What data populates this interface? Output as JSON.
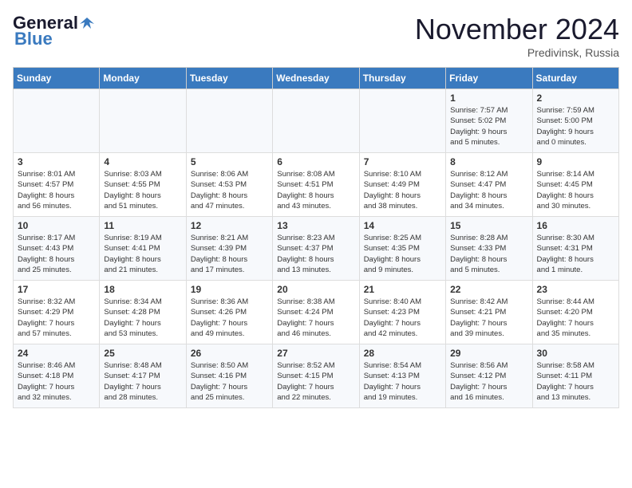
{
  "header": {
    "logo_general": "General",
    "logo_blue": "Blue",
    "month_title": "November 2024",
    "location": "Predivinsk, Russia"
  },
  "days_of_week": [
    "Sunday",
    "Monday",
    "Tuesday",
    "Wednesday",
    "Thursday",
    "Friday",
    "Saturday"
  ],
  "weeks": [
    [
      {
        "day": "",
        "detail": ""
      },
      {
        "day": "",
        "detail": ""
      },
      {
        "day": "",
        "detail": ""
      },
      {
        "day": "",
        "detail": ""
      },
      {
        "day": "",
        "detail": ""
      },
      {
        "day": "1",
        "detail": "Sunrise: 7:57 AM\nSunset: 5:02 PM\nDaylight: 9 hours\nand 5 minutes."
      },
      {
        "day": "2",
        "detail": "Sunrise: 7:59 AM\nSunset: 5:00 PM\nDaylight: 9 hours\nand 0 minutes."
      }
    ],
    [
      {
        "day": "3",
        "detail": "Sunrise: 8:01 AM\nSunset: 4:57 PM\nDaylight: 8 hours\nand 56 minutes."
      },
      {
        "day": "4",
        "detail": "Sunrise: 8:03 AM\nSunset: 4:55 PM\nDaylight: 8 hours\nand 51 minutes."
      },
      {
        "day": "5",
        "detail": "Sunrise: 8:06 AM\nSunset: 4:53 PM\nDaylight: 8 hours\nand 47 minutes."
      },
      {
        "day": "6",
        "detail": "Sunrise: 8:08 AM\nSunset: 4:51 PM\nDaylight: 8 hours\nand 43 minutes."
      },
      {
        "day": "7",
        "detail": "Sunrise: 8:10 AM\nSunset: 4:49 PM\nDaylight: 8 hours\nand 38 minutes."
      },
      {
        "day": "8",
        "detail": "Sunrise: 8:12 AM\nSunset: 4:47 PM\nDaylight: 8 hours\nand 34 minutes."
      },
      {
        "day": "9",
        "detail": "Sunrise: 8:14 AM\nSunset: 4:45 PM\nDaylight: 8 hours\nand 30 minutes."
      }
    ],
    [
      {
        "day": "10",
        "detail": "Sunrise: 8:17 AM\nSunset: 4:43 PM\nDaylight: 8 hours\nand 25 minutes."
      },
      {
        "day": "11",
        "detail": "Sunrise: 8:19 AM\nSunset: 4:41 PM\nDaylight: 8 hours\nand 21 minutes."
      },
      {
        "day": "12",
        "detail": "Sunrise: 8:21 AM\nSunset: 4:39 PM\nDaylight: 8 hours\nand 17 minutes."
      },
      {
        "day": "13",
        "detail": "Sunrise: 8:23 AM\nSunset: 4:37 PM\nDaylight: 8 hours\nand 13 minutes."
      },
      {
        "day": "14",
        "detail": "Sunrise: 8:25 AM\nSunset: 4:35 PM\nDaylight: 8 hours\nand 9 minutes."
      },
      {
        "day": "15",
        "detail": "Sunrise: 8:28 AM\nSunset: 4:33 PM\nDaylight: 8 hours\nand 5 minutes."
      },
      {
        "day": "16",
        "detail": "Sunrise: 8:30 AM\nSunset: 4:31 PM\nDaylight: 8 hours\nand 1 minute."
      }
    ],
    [
      {
        "day": "17",
        "detail": "Sunrise: 8:32 AM\nSunset: 4:29 PM\nDaylight: 7 hours\nand 57 minutes."
      },
      {
        "day": "18",
        "detail": "Sunrise: 8:34 AM\nSunset: 4:28 PM\nDaylight: 7 hours\nand 53 minutes."
      },
      {
        "day": "19",
        "detail": "Sunrise: 8:36 AM\nSunset: 4:26 PM\nDaylight: 7 hours\nand 49 minutes."
      },
      {
        "day": "20",
        "detail": "Sunrise: 8:38 AM\nSunset: 4:24 PM\nDaylight: 7 hours\nand 46 minutes."
      },
      {
        "day": "21",
        "detail": "Sunrise: 8:40 AM\nSunset: 4:23 PM\nDaylight: 7 hours\nand 42 minutes."
      },
      {
        "day": "22",
        "detail": "Sunrise: 8:42 AM\nSunset: 4:21 PM\nDaylight: 7 hours\nand 39 minutes."
      },
      {
        "day": "23",
        "detail": "Sunrise: 8:44 AM\nSunset: 4:20 PM\nDaylight: 7 hours\nand 35 minutes."
      }
    ],
    [
      {
        "day": "24",
        "detail": "Sunrise: 8:46 AM\nSunset: 4:18 PM\nDaylight: 7 hours\nand 32 minutes."
      },
      {
        "day": "25",
        "detail": "Sunrise: 8:48 AM\nSunset: 4:17 PM\nDaylight: 7 hours\nand 28 minutes."
      },
      {
        "day": "26",
        "detail": "Sunrise: 8:50 AM\nSunset: 4:16 PM\nDaylight: 7 hours\nand 25 minutes."
      },
      {
        "day": "27",
        "detail": "Sunrise: 8:52 AM\nSunset: 4:15 PM\nDaylight: 7 hours\nand 22 minutes."
      },
      {
        "day": "28",
        "detail": "Sunrise: 8:54 AM\nSunset: 4:13 PM\nDaylight: 7 hours\nand 19 minutes."
      },
      {
        "day": "29",
        "detail": "Sunrise: 8:56 AM\nSunset: 4:12 PM\nDaylight: 7 hours\nand 16 minutes."
      },
      {
        "day": "30",
        "detail": "Sunrise: 8:58 AM\nSunset: 4:11 PM\nDaylight: 7 hours\nand 13 minutes."
      }
    ]
  ]
}
